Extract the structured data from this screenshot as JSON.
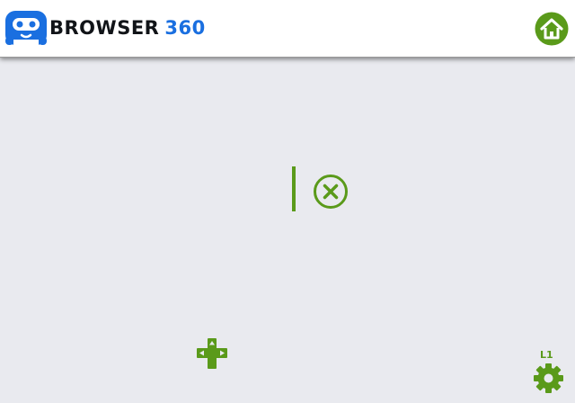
{
  "header": {
    "logo_word": "BROWSER",
    "logo_number": "360",
    "home_icon": "home-icon"
  },
  "toolbar": {
    "close_icon": "close-circle-icon",
    "gamepad_icon": "gamepad-icon",
    "settings_icon": "gear-icon",
    "settings_shortcut": "L1"
  },
  "colors": {
    "accent_green": "#5a9a1a",
    "logo_blue": "#1a6fe0",
    "logo_dark": "#111418",
    "background": "#e9eaef",
    "header_bg": "#ffffff"
  }
}
